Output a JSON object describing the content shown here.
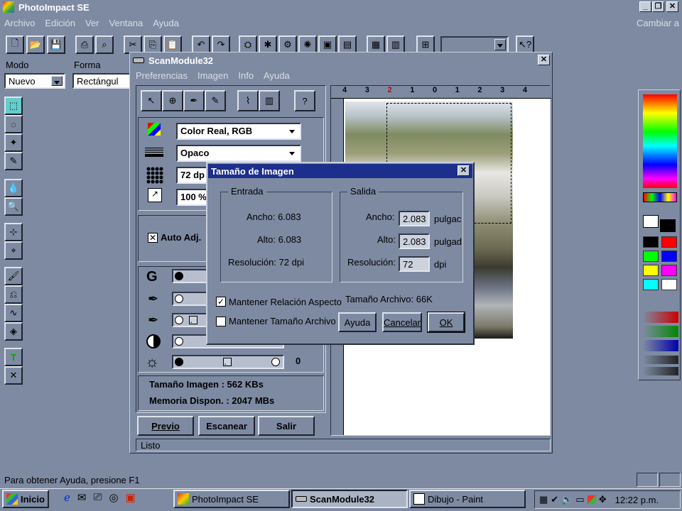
{
  "app": {
    "title": "PhotoImpact SE",
    "menu": [
      "Archivo",
      "Edición",
      "Ver",
      "Ventana",
      "Ayuda"
    ],
    "menu_right": "Cambiar a",
    "mode_label": "Modo",
    "mode_value": "Nuevo",
    "shape_label": "Forma",
    "shape_value": "Rectángul",
    "status": "Para obtener Ayuda, presione F1"
  },
  "scan": {
    "title": "ScanModule32",
    "menu": [
      "Preferencias",
      "Imagen",
      "Info",
      "Ayuda"
    ],
    "color_mode": "Color Real, RGB",
    "opacity": "Opaco",
    "resolution": "72 dp",
    "scale": "100 %",
    "auto_adjust": "Auto Adj.",
    "gamma_label": "G",
    "slider_value": "0",
    "image_size": "Tamaño Imagen : 562 KBs",
    "memory": "Memoria Dispon. : 2047 MBs",
    "btn_preview": "Previo",
    "btn_scan": "Escanear",
    "btn_exit": "Salir",
    "status": "Listo",
    "ruler_labels": [
      "4",
      "3",
      "2",
      "1",
      "0",
      "1",
      "2",
      "3",
      "4"
    ]
  },
  "dialog": {
    "title": "Tamaño de Imagen",
    "input_group": "Entrada",
    "input_width": "Ancho: 6.083",
    "input_height": "Alto: 6.083",
    "input_res": "Resolución: 72 dpi",
    "output_group": "Salida",
    "out_width_label": "Ancho:",
    "out_width_value": "2.083",
    "out_width_unit": "pulgac",
    "out_height_label": "Alto:",
    "out_height_value": "2.083",
    "out_height_unit": "pulgad",
    "out_res_label": "Resolución:",
    "out_res_value": "72",
    "out_res_unit": "dpi",
    "keep_aspect": "Mantener Relación Aspecto",
    "keep_aspect_checked": true,
    "keep_size": "Mantener Tamaño Archivo",
    "keep_size_checked": false,
    "file_size": "Tamaño Archivo:  66K",
    "btn_help": "Ayuda",
    "btn_cancel": "Cancelar",
    "btn_ok": "OK"
  },
  "taskbar": {
    "start": "Inicio",
    "tasks": [
      "PhotoImpact SE",
      "ScanModule32",
      "Dibujo - Paint"
    ],
    "clock": "12:22 p.m."
  },
  "palette": [
    "#000000",
    "#ff0000",
    "#00ff00",
    "#0000ff",
    "#ffff00",
    "#ff00ff",
    "#00ffff",
    "#ffffff"
  ]
}
